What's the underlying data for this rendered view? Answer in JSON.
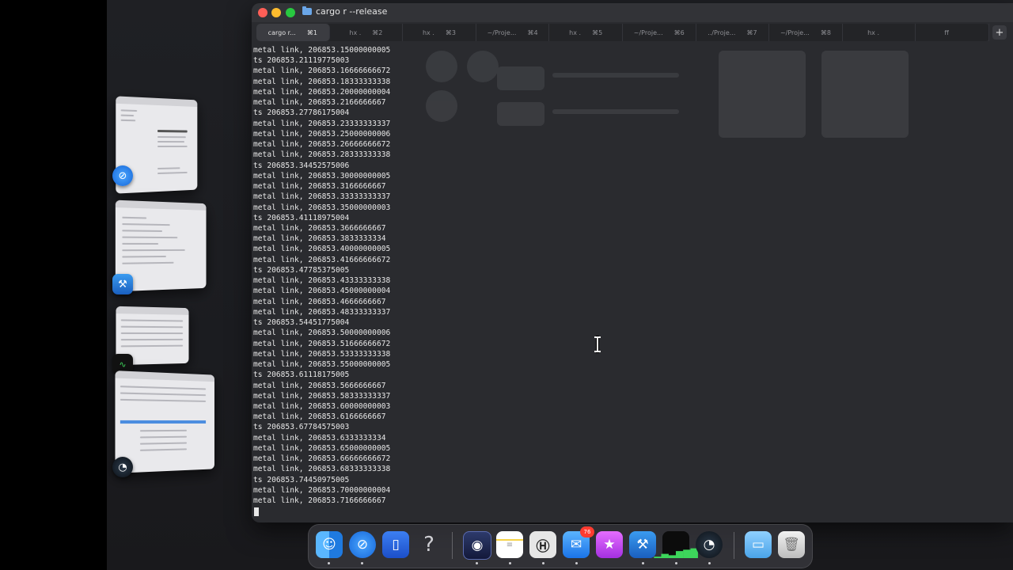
{
  "window": {
    "title": "cargo r --release"
  },
  "tabs": [
    {
      "label": "cargo r...",
      "shortcut": "⌘1",
      "active": true
    },
    {
      "label": "hx .",
      "shortcut": "⌘2"
    },
    {
      "label": "hx .",
      "shortcut": "⌘3"
    },
    {
      "label": "~/Proje...",
      "shortcut": "⌘4"
    },
    {
      "label": "hx .",
      "shortcut": "⌘5"
    },
    {
      "label": "~/Proje...",
      "shortcut": "⌘6"
    },
    {
      "label": "../Proje...",
      "shortcut": "⌘7"
    },
    {
      "label": "~/Proje...",
      "shortcut": "⌘8"
    },
    {
      "label": "hx .",
      "shortcut": ""
    },
    {
      "label": "ff",
      "shortcut": ""
    }
  ],
  "new_tab_label": "+",
  "output_lines": [
    "metal link, 206853.15000000005",
    "ts 206853.21119775003",
    "metal link, 206853.16666666672",
    "metal link, 206853.18333333338",
    "metal link, 206853.20000000004",
    "metal link, 206853.2166666667",
    "ts 206853.27786175004",
    "metal link, 206853.23333333337",
    "metal link, 206853.25000000006",
    "metal link, 206853.26666666672",
    "metal link, 206853.28333333338",
    "ts 206853.3445257500​6",
    "metal link, 206853.30000000005",
    "metal link, 206853.3166666667",
    "metal link, 206853.33333333337",
    "metal link, 206853.35000000003",
    "ts 206853.41118975004",
    "metal link, 206853.3666666667",
    "metal link, 206853.3833333334",
    "metal link, 206853.40000000005",
    "metal link, 206853.41666666672",
    "ts 206853.47785375005",
    "metal link, 206853.43333333338",
    "metal link, 206853.45000000004",
    "metal link, 206853.4666666667",
    "metal link, 206853.48333333337",
    "ts 206853.54451775004",
    "metal link, 206853.50000000006",
    "metal link, 206853.51666666672",
    "metal link, 206853.53333333338",
    "metal link, 206853.55000000005",
    "ts 206853.61118175005",
    "metal link, 206853.5666666667",
    "metal link, 206853.58333333337",
    "metal link, 206853.60000000003",
    "metal link, 206853.6166666667",
    "ts 206853.67784575003",
    "metal link, 206853.6333333334",
    "metal link, 206853.65000000005",
    "metal link, 206853.66666666672",
    "metal link, 206853.68333333338",
    "ts 206853.74450975005",
    "metal link, 206853.70000000004",
    "metal link, 206853.7166666667"
  ],
  "dock": {
    "mail_badge": "76"
  },
  "colors": {
    "terminal_bg": "#2a2b2f",
    "text": "#e8e8e8",
    "close": "#ff5f57",
    "minimize": "#febc2e",
    "zoom": "#28c840"
  }
}
